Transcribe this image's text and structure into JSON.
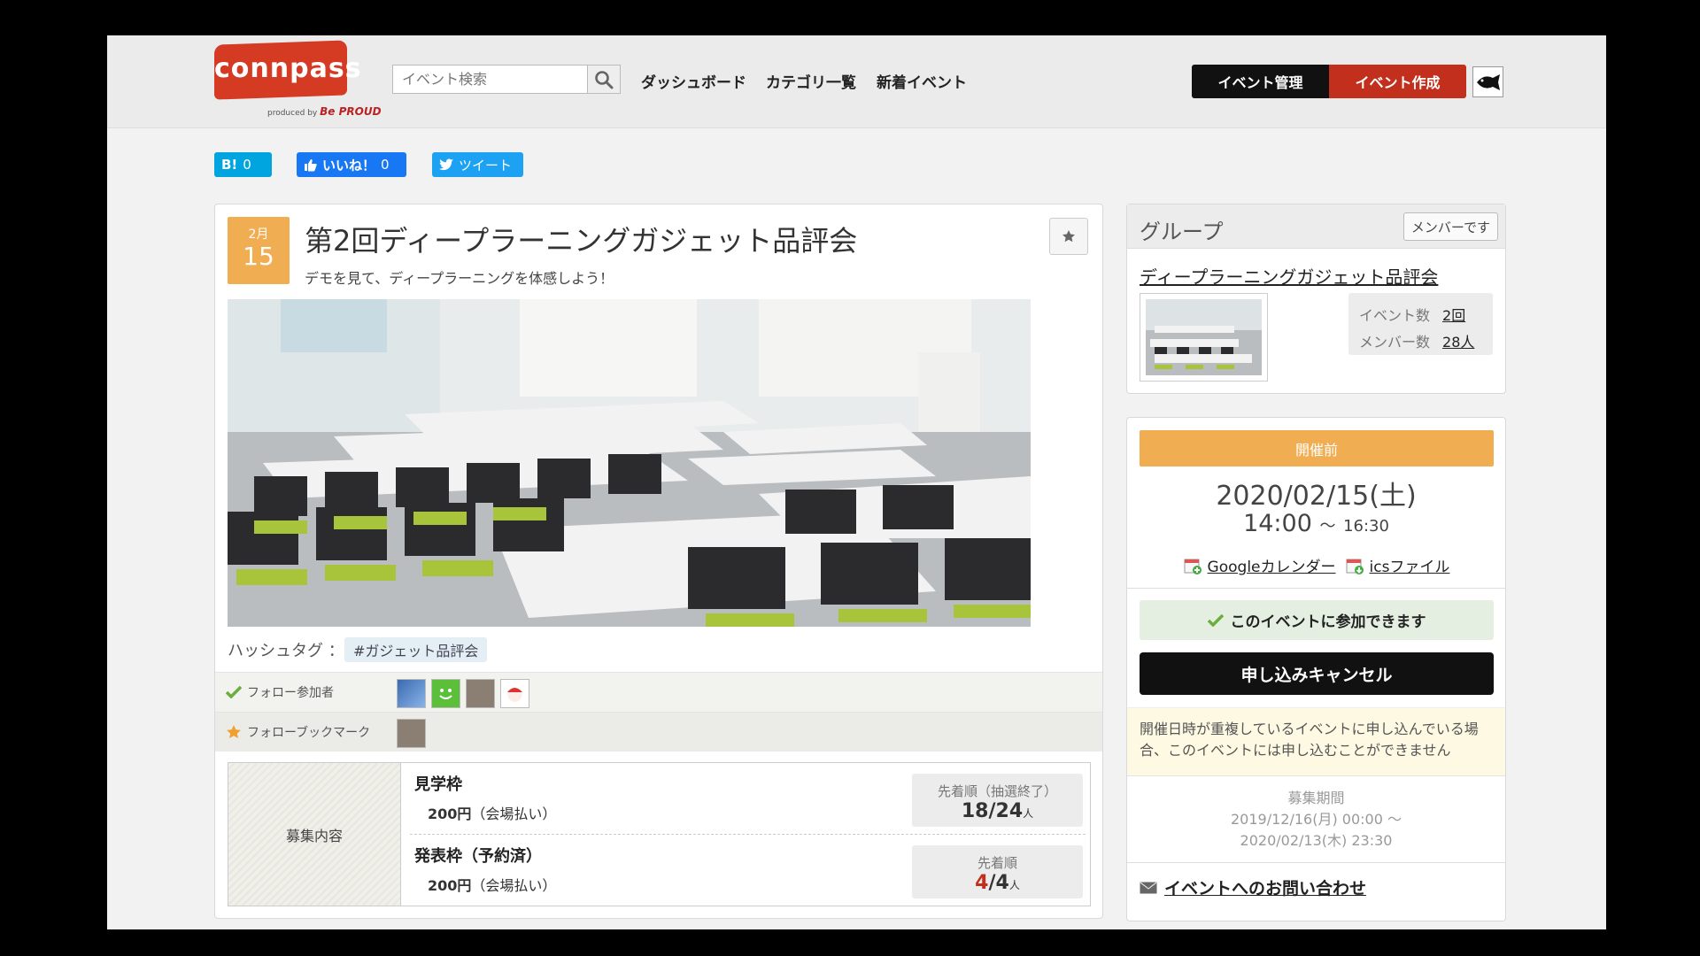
{
  "header": {
    "logo_text": "connpass",
    "logo_sub": "produced by",
    "logo_sub_brand": "Be PROUD",
    "search_placeholder": "イベント検索",
    "nav": [
      "ダッシュボード",
      "カテゴリ一覧",
      "新着イベント"
    ],
    "manage_label": "イベント管理",
    "create_label": "イベント作成"
  },
  "share": {
    "hatena_label": "B!",
    "hatena_count": "0",
    "like_label": "いいね！",
    "like_count": "0",
    "tweet_label": "ツイート"
  },
  "event": {
    "month": "2月",
    "day": "15",
    "title": "第2回ディープラーニングガジェット品評会",
    "subtitle": "デモを見て、ディープラーニングを体感しよう！",
    "hashtag_label": "ハッシュタグ ：",
    "hashtag": "#ガジェット品評会",
    "follow_participants_label": "フォロー参加者",
    "follow_bookmark_label": "フォローブックマーク",
    "recruit_label": "募集内容",
    "tiers": [
      {
        "name": "見学枠",
        "price": "200円",
        "price_note": "（会場払い）",
        "type": "先着順（抽選終了）",
        "filled": "18",
        "capacity": "24",
        "unit": "人"
      },
      {
        "name": "発表枠（予約済）",
        "price": "200円",
        "price_note": "（会場払い）",
        "type": "先着順",
        "filled": "4",
        "capacity": "4",
        "unit": "人"
      }
    ]
  },
  "group": {
    "heading": "グループ",
    "member_badge": "メンバーです",
    "name": "ディープラーニングガジェット品評会",
    "events_label": "イベント数",
    "events_value": "2回",
    "members_label": "メンバー数",
    "members_value": "28人"
  },
  "status": {
    "banner": "開催前",
    "date": "2020/02/15(土)",
    "time_start": "14:00",
    "time_sep": "～",
    "time_end": "16:30",
    "google_cal": "Googleカレンダー",
    "ics": "icsファイル",
    "can_join": "このイベントに参加できます",
    "cancel_button": "申し込みキャンセル",
    "warning": "開催日時が重複しているイベントに申し込んでいる場合、このイベントには申し込むことができません",
    "period_label": "募集期間",
    "period_start": "2019/12/16(月) 00:00 ～",
    "period_end": "2020/02/13(木) 23:30",
    "contact": "イベントへのお問い合わせ"
  },
  "colors": {
    "brand_red": "#d53a23",
    "accent_orange": "#f0ad52",
    "hatena": "#00a4de",
    "facebook": "#1877f2",
    "twitter": "#1da1f2"
  }
}
